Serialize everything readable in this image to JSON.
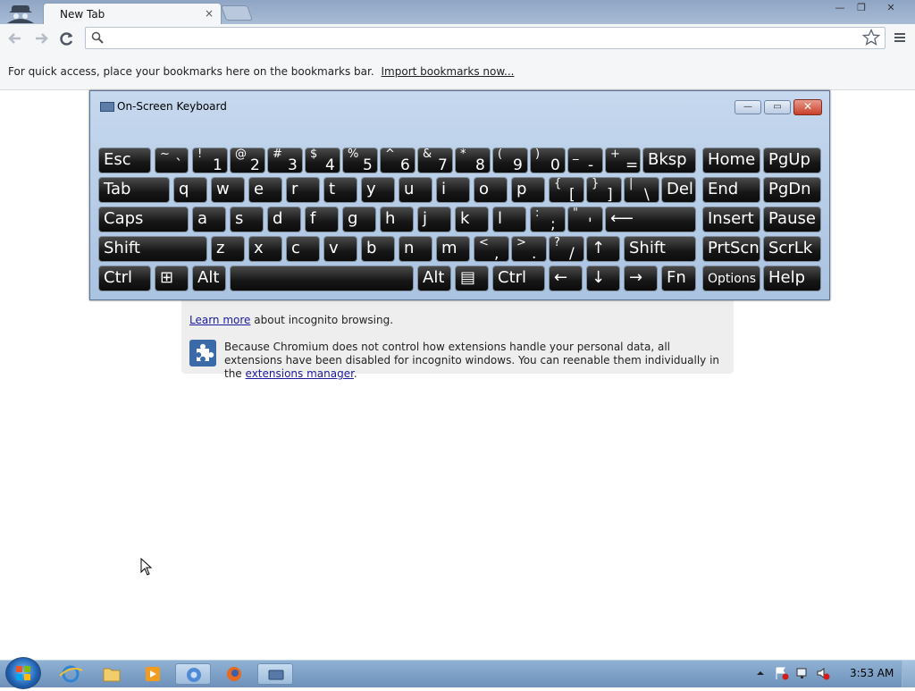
{
  "browser": {
    "tab_title": "New Tab",
    "tab_close": "×",
    "window_min": "—",
    "window_restore": "❐",
    "window_close": "✕",
    "back_icon": "back-arrow-icon",
    "forward_icon": "forward-arrow-icon",
    "reload_icon": "reload-icon",
    "search_icon": "magnifier-icon",
    "omnibox_value": "",
    "bookmark_star_icon": "star-icon",
    "wrench_icon": "wrench-menu-icon"
  },
  "bookmarks_bar": {
    "message": "For quick access, place your bookmarks here on the bookmarks bar.",
    "import_link": "Import bookmarks now..."
  },
  "incognito": {
    "learn_more": "Learn more",
    "learn_more_suffix": " about incognito browsing.",
    "extensions_text": "Because Chromium does not control how extensions handle your personal data, all extensions have been disabled for incognito windows. You can reenable them individually in the ",
    "extensions_link": "extensions manager",
    "extensions_end": "."
  },
  "osk": {
    "title": "On-Screen Keyboard",
    "min_label": "—",
    "max_label": "▭",
    "close_label": "✕",
    "rows": [
      [
        {
          "label": "Esc"
        },
        {
          "shift": "~",
          "main": "`"
        },
        {
          "shift": "!",
          "main": "1"
        },
        {
          "shift": "@",
          "main": "2"
        },
        {
          "shift": "#",
          "main": "3"
        },
        {
          "shift": "$",
          "main": "4"
        },
        {
          "shift": "%",
          "main": "5"
        },
        {
          "shift": "^",
          "main": "6"
        },
        {
          "shift": "&",
          "main": "7"
        },
        {
          "shift": "*",
          "main": "8"
        },
        {
          "shift": "(",
          "main": "9"
        },
        {
          "shift": ")",
          "main": "0"
        },
        {
          "shift": "_",
          "main": "-"
        },
        {
          "shift": "+",
          "main": "="
        },
        {
          "label": "Bksp"
        },
        {
          "label": "Home"
        },
        {
          "label": "PgUp"
        }
      ],
      [
        {
          "label": "Tab"
        },
        {
          "label": "q"
        },
        {
          "label": "w"
        },
        {
          "label": "e"
        },
        {
          "label": "r"
        },
        {
          "label": "t"
        },
        {
          "label": "y"
        },
        {
          "label": "u"
        },
        {
          "label": "i"
        },
        {
          "label": "o"
        },
        {
          "label": "p"
        },
        {
          "shift": "{",
          "main": "["
        },
        {
          "shift": "}",
          "main": "]"
        },
        {
          "shift": "|",
          "main": "\\"
        },
        {
          "label": "Del"
        },
        {
          "label": "End"
        },
        {
          "label": "PgDn"
        }
      ],
      [
        {
          "label": "Caps"
        },
        {
          "label": "a"
        },
        {
          "label": "s"
        },
        {
          "label": "d"
        },
        {
          "label": "f"
        },
        {
          "label": "g"
        },
        {
          "label": "h"
        },
        {
          "label": "j"
        },
        {
          "label": "k"
        },
        {
          "label": "l"
        },
        {
          "shift": ":",
          "main": ";"
        },
        {
          "shift": "\"",
          "main": "'"
        },
        {
          "label": "⟵"
        },
        {
          "label": "Insert"
        },
        {
          "label": "Pause"
        }
      ],
      [
        {
          "label": "Shift"
        },
        {
          "label": "z"
        },
        {
          "label": "x"
        },
        {
          "label": "c"
        },
        {
          "label": "v"
        },
        {
          "label": "b"
        },
        {
          "label": "n"
        },
        {
          "label": "m"
        },
        {
          "shift": "<",
          "main": ","
        },
        {
          "shift": ">",
          "main": "."
        },
        {
          "shift": "?",
          "main": "/"
        },
        {
          "label": "↑"
        },
        {
          "label": "Shift"
        },
        {
          "label": "PrtScn"
        },
        {
          "label": "ScrLk"
        }
      ],
      [
        {
          "label": "Ctrl"
        },
        {
          "label": "⊞"
        },
        {
          "label": "Alt"
        },
        {
          "label": ""
        },
        {
          "label": "Alt"
        },
        {
          "label": "▤"
        },
        {
          "label": "Ctrl"
        },
        {
          "label": "←"
        },
        {
          "label": "↓"
        },
        {
          "label": "→"
        },
        {
          "label": "Fn"
        },
        {
          "label": "Options"
        },
        {
          "label": "Help"
        }
      ]
    ]
  },
  "taskbar": {
    "start_icon": "windows-orb-icon",
    "pinned": [
      "internet-explorer-icon",
      "folder-icon",
      "media-player-icon",
      "chromium-icon",
      "firefox-icon",
      "keyboard-icon"
    ],
    "clock": "3:53 AM",
    "tray": [
      "show-hidden-icon",
      "flag-icon",
      "network-icon",
      "volume-icon"
    ]
  }
}
